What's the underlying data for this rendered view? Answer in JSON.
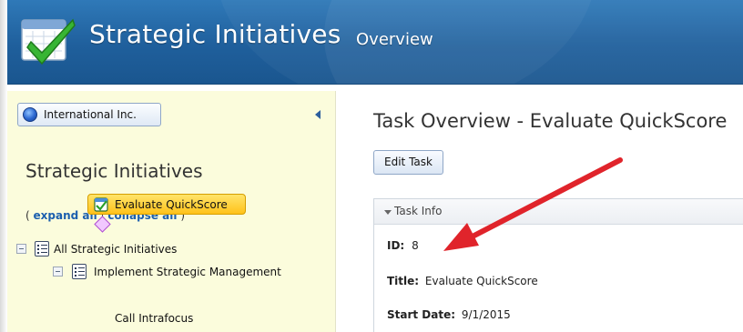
{
  "header": {
    "app_title": "Strategic Initiatives",
    "section": "Overview",
    "logo_icon": "checkmark-calendar-icon",
    "background_color": "#1f5f9c"
  },
  "sidebar": {
    "org_button_label": "International Inc.",
    "org_icon": "globe-icon",
    "collapse_icon": "chevron-left-icon",
    "title": "Strategic Initiatives",
    "expand_all": "expand all",
    "separator": "|",
    "collapse_all": "collapse all",
    "open_paren": "(",
    "close_paren": ")",
    "background_color": "#fbfcdc",
    "tree": {
      "root_label": "All Strategic Initiatives",
      "child_label": "Implement Strategic Management",
      "selected_task_label": "Evaluate QuickScore",
      "next_task_label": "Call Intrafocus"
    }
  },
  "main": {
    "title": "Task Overview - Evaluate QuickScore",
    "edit_button_label": "Edit Task",
    "panel": {
      "header_label": "Task Info",
      "fields": {
        "id_label": "ID:",
        "id_value": "8",
        "title_label": "Title:",
        "title_value": "Evaluate QuickScore",
        "start_label": "Start Date:",
        "start_value": "9/1/2015"
      }
    }
  },
  "annotation": {
    "arrow_color": "#e0242b",
    "arrow_icon": "red-arrow-icon"
  }
}
